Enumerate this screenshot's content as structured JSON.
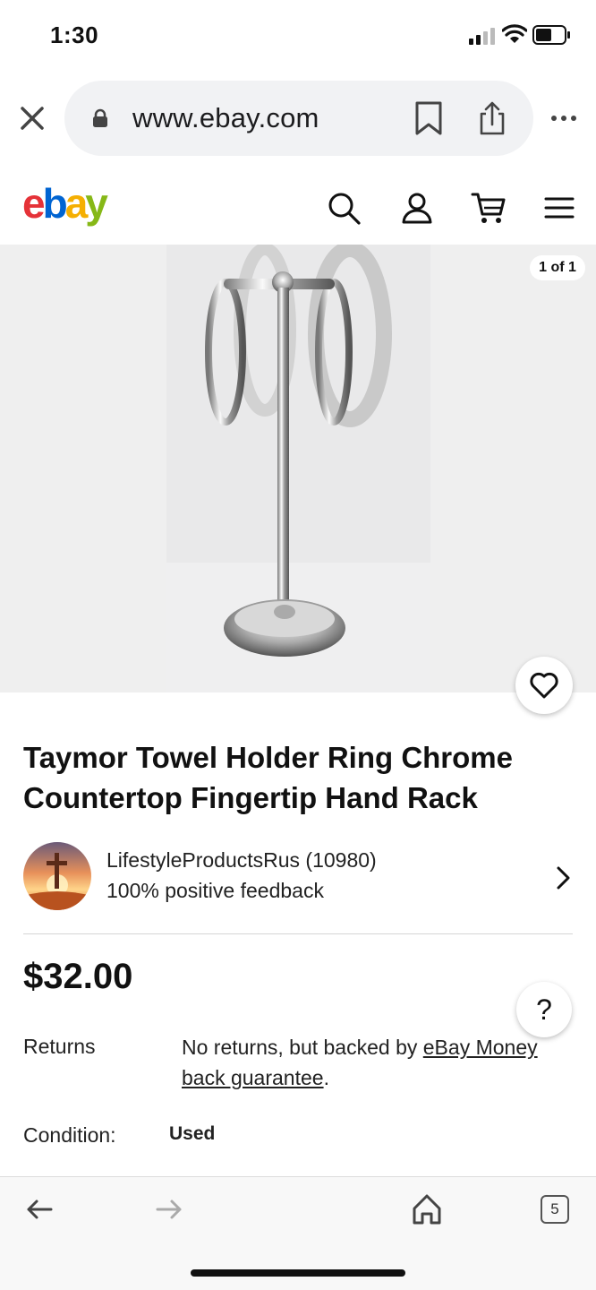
{
  "status_bar": {
    "time": "1:30"
  },
  "browser": {
    "url": "www.ebay.com",
    "tab_count": "5"
  },
  "brand": {
    "colors": [
      "#e53238",
      "#0064d2",
      "#f5af02",
      "#86b817"
    ]
  },
  "gallery": {
    "counter": "1 of 1"
  },
  "listing": {
    "title": "Taymor Towel Holder Ring Chrome Countertop Fingertip Hand Rack",
    "seller_name": "LifestyleProductsRus (10980)",
    "seller_feedback": "100% positive feedback",
    "price": "$32.00",
    "returns_label": "Returns",
    "returns_text_pre": "No returns, but backed by ",
    "returns_link": "eBay Money back guarantee",
    "returns_text_post": ".",
    "condition_label": "Condition:",
    "condition_value": "Used"
  },
  "help": {
    "label": "?"
  }
}
